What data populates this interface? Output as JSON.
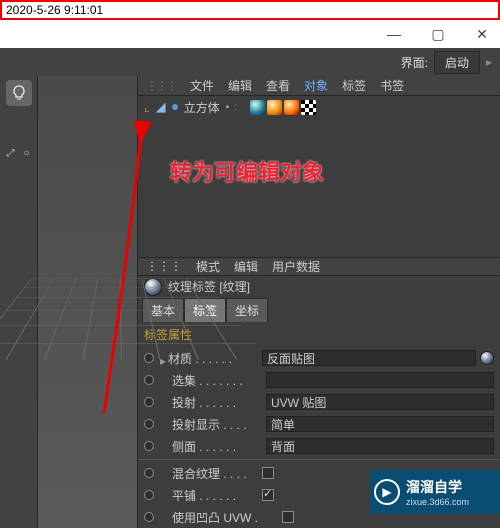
{
  "timestamp": "2020-5-26 9:11:01",
  "interface_label": "界面:",
  "interface_value": "启动",
  "annotation": "转为可编辑对象",
  "obj_menu": {
    "file": "文件",
    "edit": "编辑",
    "view": "查看",
    "objects": "对象",
    "tags": "标签",
    "bookmarks": "书签"
  },
  "object_item": {
    "name": "立方体"
  },
  "attr_menu": {
    "mode": "模式",
    "edit": "编辑",
    "userdata": "用户数据"
  },
  "material_line": "纹理标签 [纹理]",
  "tabs": {
    "basic": "基本",
    "tag": "标签",
    "coord": "坐标"
  },
  "section_title": "标签属性",
  "props": {
    "material": {
      "label": "材质",
      "dots": " . . . . . . ",
      "value": "反面贴图"
    },
    "selection": {
      "label": "选集",
      "dots": " . . . . . . . ",
      "value": ""
    },
    "projection": {
      "label": "投射",
      "dots": " . . . . . . ",
      "value": "UVW 贴图"
    },
    "projdisplay": {
      "label": "投射显示",
      "dots": " . . . . ",
      "value": "简单"
    },
    "side": {
      "label": "侧面",
      "dots": " . . . . . . ",
      "value": "背面"
    },
    "mixtex": {
      "label": "混合纹理",
      "dots": " . . . . ",
      "checked": false
    },
    "tile": {
      "label": "平铺",
      "dots": " . . . . . . ",
      "checked": true
    },
    "useuvw": {
      "label": "使用凹凸 UVW",
      "dots": " . ",
      "checked": false
    }
  },
  "logo": {
    "brand": "溜溜自学",
    "url": "zixue.3d66.com"
  }
}
